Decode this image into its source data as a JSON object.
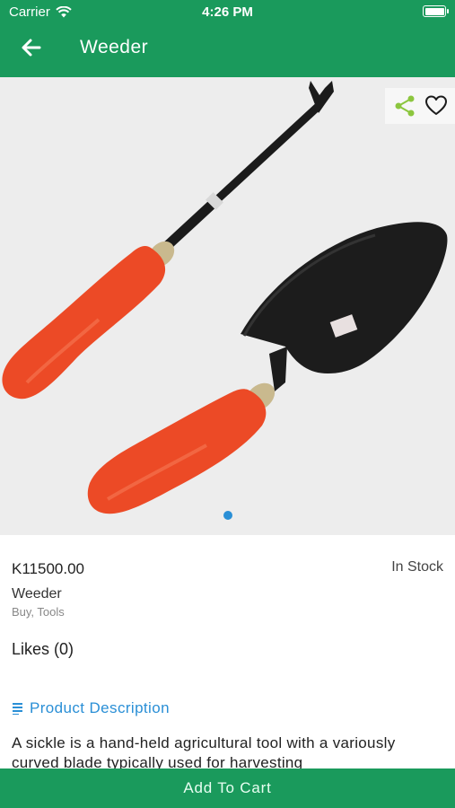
{
  "status_bar": {
    "carrier": "Carrier",
    "time": "4:26 PM"
  },
  "header": {
    "title": "Weeder",
    "back_icon": "arrow-left-icon"
  },
  "gallery": {
    "actions": {
      "share_icon": "share-icon",
      "favorite_icon": "heart-outline-icon"
    },
    "page_count": 1,
    "active_index": 0
  },
  "product": {
    "price": "K11500.00",
    "stock": "In Stock",
    "name": "Weeder",
    "categories": "Buy, Tools",
    "likes": "Likes (0)"
  },
  "description": {
    "heading": "Product Description",
    "text": "A sickle is a hand-held agricultural tool with a variously curved blade typically used for harvesting"
  },
  "cart": {
    "label": "Add To Cart"
  },
  "colors": {
    "primary": "#1a9a5c",
    "accent": "#2a8fd6",
    "share": "#8cc63f"
  }
}
